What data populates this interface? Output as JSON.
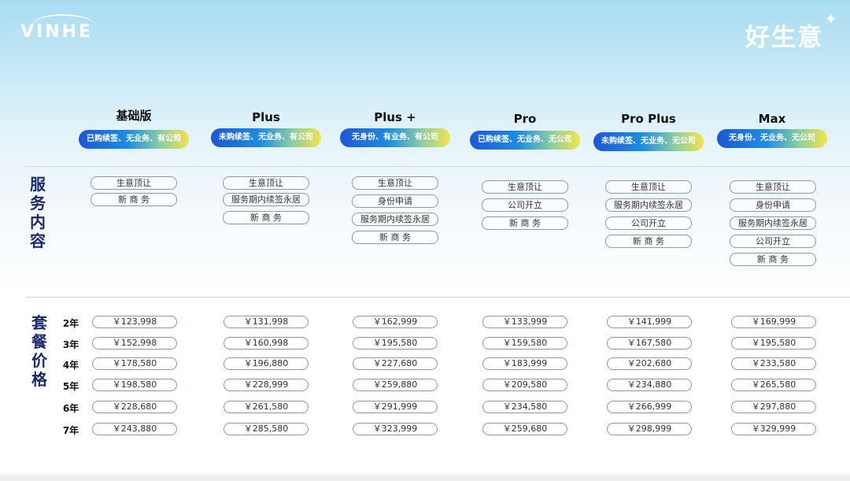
{
  "header": {
    "logo_text": "VINHE",
    "brand_text": "好生意",
    "brand_star": "✦"
  },
  "section_labels": {
    "services": "服务内容",
    "prices": "套餐价格"
  },
  "years": [
    "2年",
    "3年",
    "4年",
    "5年",
    "6年",
    "7年"
  ],
  "plans": [
    {
      "title": "基础版",
      "badge": "已购续签、无业务、有公司",
      "services": [
        "生意顶让",
        "新 商 务"
      ],
      "prices": [
        "￥123,998",
        "￥152,998",
        "￥178,580",
        "￥198,580",
        "￥228,680",
        "￥243,880"
      ]
    },
    {
      "title": "Plus",
      "badge": "未购续签、无业务、有公司",
      "services": [
        "生意顶让",
        "服务期内续签永居",
        "新 商 务"
      ],
      "prices": [
        "￥131,998",
        "￥160,998",
        "￥196,880",
        "￥228,999",
        "￥261,580",
        "￥285,580"
      ]
    },
    {
      "title": "Plus +",
      "badge": "无身份、有业务、有公司",
      "services": [
        "生意顶让",
        "身份申请",
        "服务期内续签永居",
        "新 商 务"
      ],
      "prices": [
        "￥162,999",
        "￥195,580",
        "￥227,680",
        "￥259,880",
        "￥291,999",
        "￥323,999"
      ]
    },
    {
      "title": "Pro",
      "badge": "已购续签、无业务、无公司",
      "services": [
        "生意顶让",
        "公司开立",
        "新 商 务"
      ],
      "prices": [
        "￥133,999",
        "￥159,580",
        "￥183,999",
        "￥209,580",
        "￥234,580",
        "￥259,680"
      ]
    },
    {
      "title": "Pro Plus",
      "badge": "未购续签、无业务、无公司",
      "services": [
        "生意顶让",
        "服务期内续签永居",
        "公司开立",
        "新 商 务"
      ],
      "prices": [
        "￥141,999",
        "￥167,580",
        "￥202,680",
        "￥234,880",
        "￥266,999",
        "￥298,999"
      ]
    },
    {
      "title": "Max",
      "badge": "无身份、无业务、无公司",
      "services": [
        "生意顶让",
        "身份申请",
        "服务期内续签永居",
        "公司开立",
        "新 商 务"
      ],
      "prices": [
        "￥169,999",
        "￥195,580",
        "￥233,580",
        "￥265,580",
        "￥297,880",
        "￥329,999"
      ]
    }
  ]
}
